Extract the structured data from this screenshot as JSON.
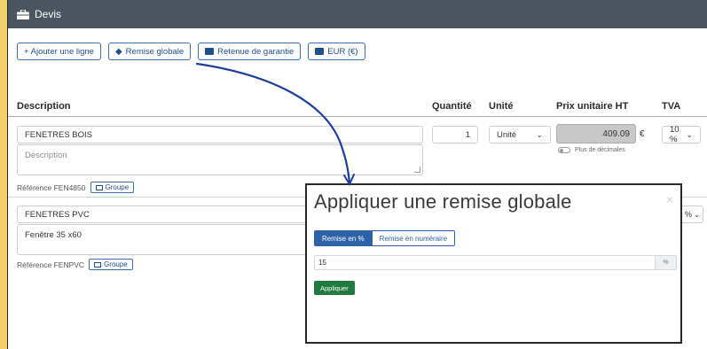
{
  "window": {
    "title": "Devis"
  },
  "toolbar": {
    "add_line": "+ Ajouter une ligne",
    "global_discount": "Remise globale",
    "retention": "Retenue de garantie",
    "currency": "EUR (€)"
  },
  "columns": {
    "description": "Description",
    "quantity": "Quantité",
    "unit": "Unité",
    "unit_price": "Prix unitaire HT",
    "vat": "TVA"
  },
  "rows": [
    {
      "title": "FENETRES BOIS",
      "description_placeholder": "Description",
      "reference": "Référence FEN4850",
      "group": "Groupe",
      "quantity": "1",
      "unit": "Unité",
      "price": "409.09",
      "currency": "€",
      "decimals_toggle": "Plus de décimales",
      "vat": "10 %"
    },
    {
      "title": "FENETRES PVC",
      "description": "Fenêtre 35 x60",
      "reference": "Référence FENPVC",
      "group": "Groupe",
      "vat_fragment": "%"
    }
  ],
  "modal": {
    "title": "Appliquer une remise globale",
    "close": "×",
    "tab_percent": "Remise en %",
    "tab_cash": "Remise en numéraire",
    "value": "15",
    "suffix": "%",
    "apply": "Appliquer"
  },
  "colors": {
    "titlebar": "#4a5560",
    "accent_blue": "#2d62a8",
    "apply_green": "#1f7a40",
    "annotation_arrow": "#1c3e9c",
    "background_yellow": "#f4cf6a"
  },
  "icons": {
    "window": "briefcase-icon",
    "discount": "tag-icon",
    "retention": "id-card-icon",
    "currency": "money-icon",
    "group": "group-icon",
    "unit_dropdown": "chevron-down-icon"
  }
}
